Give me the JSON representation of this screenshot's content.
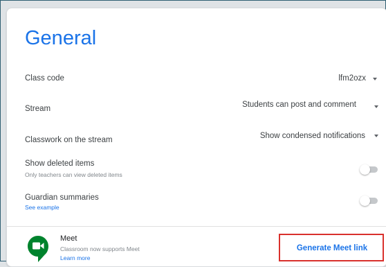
{
  "page": {
    "title": "General"
  },
  "settings": {
    "class_code": {
      "label": "Class code",
      "value": "lfm2ozx"
    },
    "stream": {
      "label": "Stream",
      "value": "Students can post and comment"
    },
    "classwork": {
      "label": "Classwork on the stream",
      "value": "Show condensed notifications"
    },
    "deleted": {
      "label": "Show deleted items",
      "description": "Only teachers can view deleted items",
      "enabled": false
    },
    "guardian": {
      "label": "Guardian summaries",
      "link": "See example",
      "enabled": false
    }
  },
  "meet": {
    "title": "Meet",
    "description": "Classroom now supports Meet",
    "link": "Learn more",
    "button": "Generate Meet link"
  },
  "colors": {
    "accent": "#1a73e8",
    "highlight": "#d9302c",
    "meet_green": "#00832d"
  },
  "icons": [
    "chevron-down-icon",
    "google-meet-icon"
  ]
}
